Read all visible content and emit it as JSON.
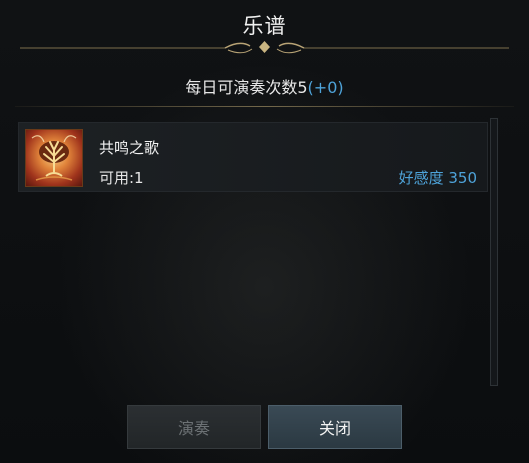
{
  "window": {
    "title": "乐谱"
  },
  "summary": {
    "label": "每日可演奏次数5",
    "bonus": "(+0)"
  },
  "songs": [
    {
      "name": "共鸣之歌",
      "available": "可用:1",
      "favor": "好感度 350",
      "icon": "tree-emblem-icon"
    }
  ],
  "buttons": {
    "play": "演奏",
    "close": "关闭"
  },
  "colors": {
    "accent_blue": "#4ea3d9",
    "gold_ornament": "#b9a476",
    "disabled_text": "#6d7275"
  }
}
